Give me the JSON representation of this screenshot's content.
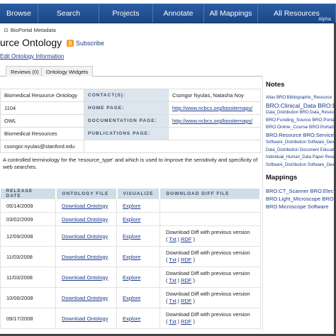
{
  "nav": {
    "tabs": [
      {
        "label": "Browse",
        "sub": ""
      },
      {
        "label": "Search",
        "sub": ""
      },
      {
        "label": "Projects",
        "sub": ""
      },
      {
        "label": "Annotate",
        "sub": ""
      },
      {
        "label": "All Mappings",
        "sub": ""
      },
      {
        "label": "All Resources",
        "sub": "Alpha"
      }
    ]
  },
  "breadcrumb": "BioPortal Metadata",
  "page": {
    "title": "urce Ontology",
    "subscribe": "Subscribe",
    "edit_link": "Edit Ontology Information",
    "rss_icon": "rss-icon"
  },
  "tabs": [
    {
      "label": "Reviews (0)"
    },
    {
      "label": "Ontology Widgets"
    }
  ],
  "info": {
    "left_values": [
      "Biomedical Resource Ontology",
      "1104",
      "OWL",
      "Biomedical Resources",
      "csongor.nyulas@stanford.edu"
    ],
    "labels": [
      "CONTACT(S):",
      "HOME PAGE:",
      "DOCUMENTATION PAGE:",
      "PUBLICATIONS PAGE:"
    ],
    "contacts": "Csongor Nyulas, Natasha Noy",
    "home_page": "http://www.ncbcs.org/biositemaps/",
    "documentation_page": "http://www.ncbcs.org/biositemaps/",
    "publications_page": ""
  },
  "description": "A controlled terminology for the 'resource_type' and which is used to improve the sensitivity and specificity of web searches.",
  "history": {
    "headers": [
      "RELEASE DATE",
      "ONTOLOGY FILE",
      "VISUALIZE",
      "DOWNLOAD DIFF FILE"
    ],
    "download_label": "Download Ontology",
    "explore_label": "Explore",
    "diff_text": "Download Diff with previous version",
    "txt_label": "Txt",
    "rdf_label": "RDF",
    "rows": [
      {
        "date": "05/14/2009",
        "diff": false
      },
      {
        "date": "03/02/2009",
        "diff": false
      },
      {
        "date": "12/09/2008",
        "diff": true
      },
      {
        "date": "11/03/2008",
        "diff": true
      },
      {
        "date": "11/03/2008",
        "diff": true
      },
      {
        "date": "10/06/2008",
        "diff": true
      },
      {
        "date": "09/17/2008",
        "diff": true
      }
    ]
  },
  "notes": {
    "title": "Notes",
    "cloud": [
      "Atlas BRO:Bibliographic_Resource",
      "BRO:Clinical_Data BRO:Data",
      "Data_Distribution BRO:Data_Resource",
      "BRO:Funding_Source BRO:Portals BRO",
      "BRO:Online_Course BRO:Portals BRO",
      "BRO:Resource BRO:Service BRO:",
      "Software_Distribution Software_Deve",
      "Data_Distribution Document Educatio",
      "Individual_Human_Data Paper Resear",
      "Software_Distribution Software_Deve"
    ]
  },
  "mappings": {
    "title": "Mappings",
    "items": [
      "BRO:CT_Scanner BRO:Electro",
      "BRO:Light_Microscope BRO:M",
      "BRO:Microscope Software"
    ]
  }
}
